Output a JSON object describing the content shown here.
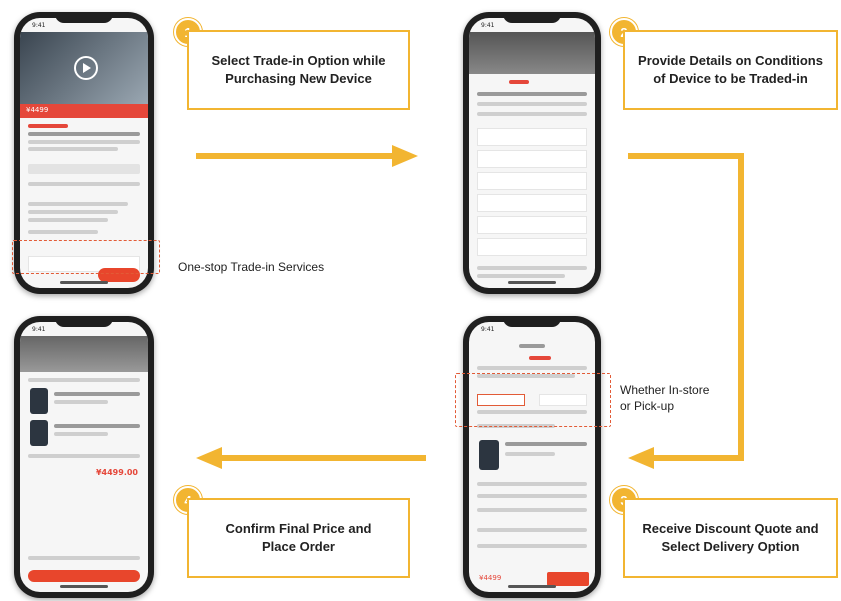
{
  "steps": [
    {
      "number": "1",
      "text": "Select Trade-in Option while Purchasing New Device"
    },
    {
      "number": "2",
      "text": "Provide Details on Conditions of Device to be Traded-in"
    },
    {
      "number": "3",
      "text": "Receive Discount Quote and Select Delivery Option"
    },
    {
      "number": "4",
      "text": "Confirm Final Price and Place Order"
    }
  ],
  "notes": {
    "one_stop": "One-stop Trade-in Services",
    "delivery_line1": "Whether In-store",
    "delivery_line2": "or Pick-up"
  },
  "phones": {
    "p1_time": "9:41",
    "p1_price": "¥4499",
    "p2_time": "9:41",
    "p3_time": "9:41",
    "p3_price": "¥4499",
    "p4_time": "9:41",
    "p4_price": "¥4499.00"
  },
  "colors": {
    "accent": "#f2b531",
    "highlight": "#e25b37",
    "action": "#e8462c"
  },
  "icons": [
    "arrow-right-icon",
    "arrow-down-icon",
    "arrow-left-icon",
    "play-icon"
  ]
}
